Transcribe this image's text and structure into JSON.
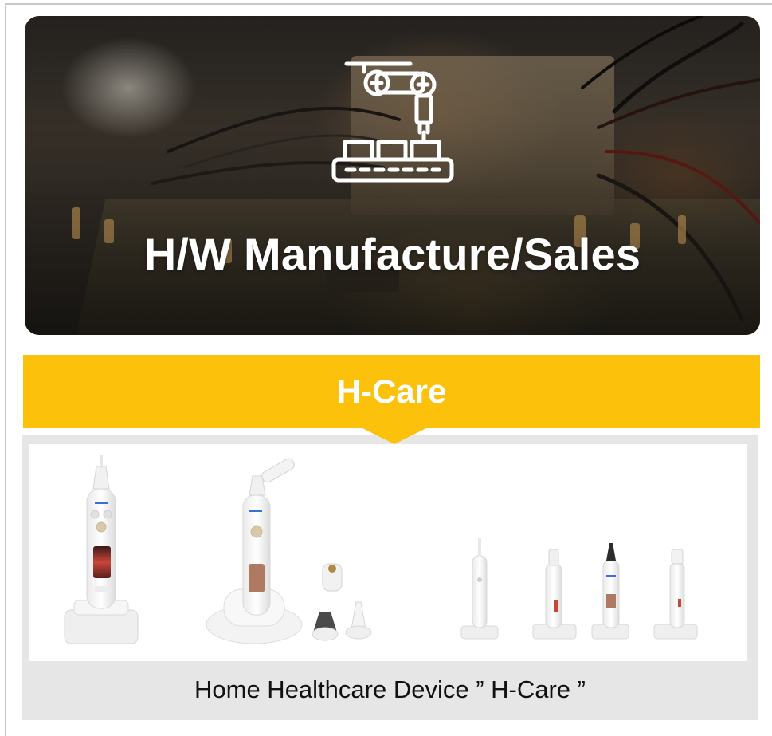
{
  "hero": {
    "title": "H/W Manufacture/Sales",
    "icon": "robot-arm-assembly-line-icon"
  },
  "product": {
    "name": "H-Care",
    "accent_color": "#fcc10b",
    "caption": "Home Healthcare Device ” H-Care ”",
    "image": "h-care-device-lineup"
  }
}
